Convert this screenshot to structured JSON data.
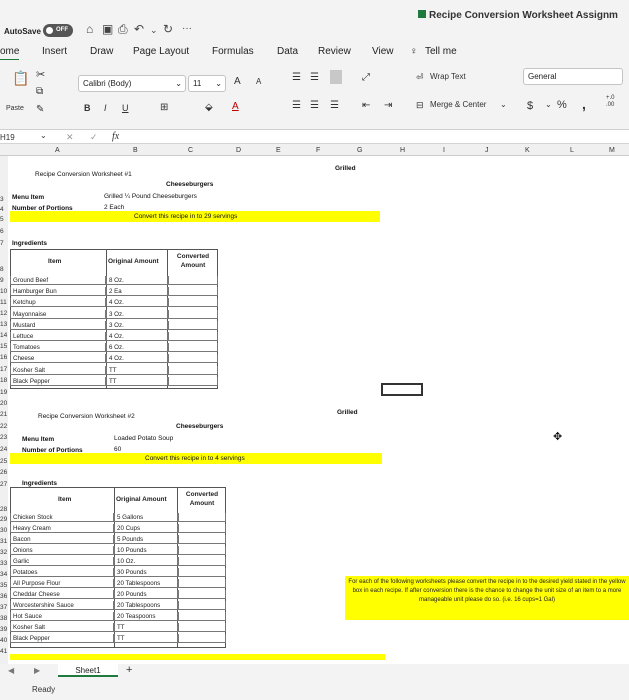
{
  "titlebar": {
    "autosave": "AutoSave",
    "toggle": "OFF",
    "more": "···",
    "title": "Recipe Conversion Worksheet Assignm"
  },
  "tabs": [
    "ome",
    "Insert",
    "Draw",
    "Page Layout",
    "Formulas",
    "Data",
    "Review",
    "View"
  ],
  "tell_me": "Tell me",
  "ribbon": {
    "paste": "Paste",
    "font_name": "Calibri (Body)",
    "font_size": "11",
    "grow_font": "A",
    "shrink_font": "A",
    "bold": "B",
    "italic": "I",
    "underline": "U",
    "wrap_text": "Wrap Text",
    "merge_center": "Merge & Center",
    "number_format": "General",
    "currency": "$",
    "percent": "%",
    "comma": ",",
    "decimals": "+.0\n.00"
  },
  "formula_bar": {
    "name_box": "H19",
    "cancel": "✕",
    "enter": "✓",
    "fx": "fx"
  },
  "columns": [
    "A",
    "B",
    "C",
    "D",
    "E",
    "F",
    "G",
    "H",
    "I",
    "J",
    "K",
    "L",
    "M"
  ],
  "rows": [
    "",
    "",
    "",
    "",
    "",
    "",
    "",
    "",
    "",
    "",
    "",
    "",
    "",
    "",
    "",
    "",
    "",
    "",
    "",
    "",
    "",
    "",
    "",
    "",
    "",
    "",
    "",
    "",
    "",
    "",
    "",
    "",
    "",
    "",
    "",
    "",
    "",
    "",
    "",
    "",
    "",
    ""
  ],
  "row_labels": [
    "3",
    "4",
    "5",
    "6",
    "7",
    "8",
    "9",
    "10",
    "11",
    "12",
    "13",
    "14",
    "15",
    "16",
    "17",
    "18",
    "19",
    "20",
    "21",
    "22",
    "23",
    "24",
    "25",
    "26",
    "27",
    "28",
    "29",
    "30",
    "31",
    "32",
    "33",
    "34",
    "35",
    "36",
    "37",
    "38",
    "39",
    "40",
    "41"
  ],
  "ws1": {
    "title": "Recipe Conversion Worksheet #1",
    "grilled": "Grilled",
    "cheeseburgers": "Cheeseburgers",
    "menu_label": "Menu Item",
    "menu_value": "Grilled ¼ Pound Cheeseburgers",
    "portions_label": "Number of Portions",
    "portions_value": "2 Each",
    "instruction": "Convert this recipe in to 29 servings",
    "ingredients": "Ingredients",
    "col_item": "Item",
    "col_original": "Original Amount",
    "col_converted": "Converted Amount",
    "items": [
      {
        "item": "Ground Beef",
        "amount": "8 Oz."
      },
      {
        "item": "Hamburger Bun",
        "amount": "2 Ea"
      },
      {
        "item": "Ketchup",
        "amount": "4 Oz."
      },
      {
        "item": "Mayonnaise",
        "amount": "3 Oz."
      },
      {
        "item": "Mustard",
        "amount": "3 Oz."
      },
      {
        "item": "Lettuce",
        "amount": "4 Oz."
      },
      {
        "item": "Tomatoes",
        "amount": "6 Oz."
      },
      {
        "item": "Cheese",
        "amount": "4 Oz."
      },
      {
        "item": "Kosher Salt",
        "amount": "TT"
      },
      {
        "item": "Black Pepper",
        "amount": "TT"
      }
    ]
  },
  "ws2": {
    "title": "Recipe Conversion Worksheet #2",
    "grilled": "Grilled",
    "cheeseburgers": "Cheeseburgers",
    "menu_label": "Menu Item",
    "menu_value": "Loaded Potato Soup",
    "portions_label": "Number of Portions",
    "portions_value": "60",
    "instruction": "Convert this recipe in to 4 servings",
    "ingredients": "Ingredients",
    "col_item": "Item",
    "col_original": "Original Amount",
    "col_converted": "Converted Amount",
    "items": [
      {
        "item": "Chicken Stock",
        "amount": "5 Gallons"
      },
      {
        "item": "Heavy Cream",
        "amount": "20 Cups"
      },
      {
        "item": "Bacon",
        "amount": "5 Pounds"
      },
      {
        "item": "Onions",
        "amount": "10 Pounds"
      },
      {
        "item": "Garlic",
        "amount": "10 Oz."
      },
      {
        "item": "Potatoes",
        "amount": "30 Pounds"
      },
      {
        "item": "All Purpose Flour",
        "amount": "20 Tablespoons"
      },
      {
        "item": "Cheddar Cheese",
        "amount": "20 Pounds"
      },
      {
        "item": "Worcestershire Sauce",
        "amount": "20 Tablespoons"
      },
      {
        "item": "Hot Sauce",
        "amount": "20 Teaspoons"
      },
      {
        "item": "Kosher Salt",
        "amount": "TT"
      },
      {
        "item": "Black Pepper",
        "amount": "TT"
      }
    ]
  },
  "note": "For each of the following worksheets please convert the recipe in to the desired yield stated in the yellow box in each recipe. If after conversion there is the chance to change the unit size of an item to a more manageable unit please do so. (i.e. 16 cups=1 Gal)",
  "sheet_tab": "Sheet1",
  "add_sheet": "+",
  "status": "Ready",
  "colors": {
    "yellow": "#ffff00",
    "excel_green": "#1f7a3d"
  }
}
